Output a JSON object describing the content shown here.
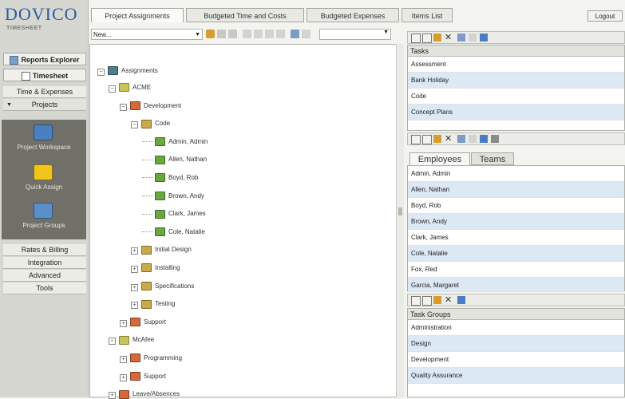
{
  "app": {
    "brand": "DOVICO",
    "brand_sub": "TIMESHEET"
  },
  "sidebar": {
    "reports_explorer": "Reports Explorer",
    "timesheet": "Timesheet",
    "time_expenses": "Time & Expenses",
    "projects": "Projects",
    "panel_items": [
      "Project Workspace",
      "Quick Assign",
      "Project Groups"
    ],
    "lower_items": [
      "Rates & Billing",
      "Integration",
      "Advanced",
      "Tools"
    ]
  },
  "tabs": [
    "Project Assignments",
    "Budgeted Time and Costs",
    "Budgeted Expenses",
    "Items List"
  ],
  "logout": "Logout",
  "toolbar": {
    "new_select": "New...",
    "filter_value": ""
  },
  "tree": {
    "root": "Assignments",
    "nodes": [
      {
        "label": "ACME",
        "kind": "clients",
        "level": 1,
        "exp": "−"
      },
      {
        "label": "Development",
        "kind": "project",
        "level": 2,
        "exp": "−"
      },
      {
        "label": "Code",
        "kind": "task",
        "level": 3,
        "exp": "−"
      },
      {
        "label": "Admin, Admin",
        "kind": "emp",
        "level": 4,
        "exp": ""
      },
      {
        "label": "Allen, Nathan",
        "kind": "emp",
        "level": 4,
        "exp": ""
      },
      {
        "label": "Boyd, Rob",
        "kind": "emp",
        "level": 4,
        "exp": ""
      },
      {
        "label": "Brown, Andy",
        "kind": "emp",
        "level": 4,
        "exp": ""
      },
      {
        "label": "Clark, James",
        "kind": "emp",
        "level": 4,
        "exp": ""
      },
      {
        "label": "Cole, Natalie",
        "kind": "emp",
        "level": 4,
        "exp": ""
      },
      {
        "label": "Initial Design",
        "kind": "task",
        "level": 3,
        "exp": "+"
      },
      {
        "label": "Installing",
        "kind": "task",
        "level": 3,
        "exp": "+"
      },
      {
        "label": "Specifications",
        "kind": "task",
        "level": 3,
        "exp": "+"
      },
      {
        "label": "Testing",
        "kind": "task",
        "level": 3,
        "exp": "+"
      },
      {
        "label": "Support",
        "kind": "project",
        "level": 2,
        "exp": "+"
      },
      {
        "label": "McAfee",
        "kind": "clients",
        "level": 1,
        "exp": "−"
      },
      {
        "label": "Programming",
        "kind": "project",
        "level": 2,
        "exp": "+"
      },
      {
        "label": "Support",
        "kind": "project",
        "level": 2,
        "exp": "+"
      },
      {
        "label": "Leave/Absences",
        "kind": "project",
        "level": 1,
        "exp": "+"
      }
    ]
  },
  "tasks_panel": {
    "header": "Tasks",
    "rows": [
      "Assessment",
      "Bank Holiday",
      "Code",
      "Concept Plans"
    ]
  },
  "employees_panel": {
    "tabs": [
      "Employees",
      "Teams"
    ],
    "rows": [
      "Admin, Admin",
      "Allen, Nathan",
      "Boyd, Rob",
      "Brown, Andy",
      "Clark, James",
      "Cole, Natalie",
      "Fox, Red",
      "Garcia, Margaret"
    ]
  },
  "task_groups_panel": {
    "header": "Task Groups",
    "rows": [
      "Administration",
      "Design",
      "Development",
      "Quality Assurance"
    ]
  },
  "colors": {
    "brand": "#2d5d9c",
    "row_alt": "#dde8f5",
    "sidebar_dark": "#707068"
  }
}
